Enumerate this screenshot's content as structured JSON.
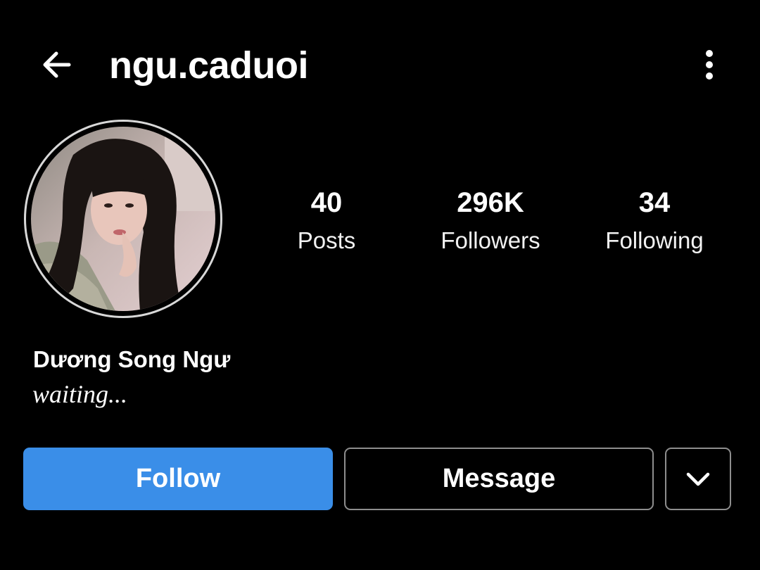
{
  "header": {
    "username": "ngu.caduoi",
    "back_icon": "arrow-left-icon",
    "more_icon": "vertical-dots-icon"
  },
  "profile": {
    "avatar": "profile-photo",
    "display_name": "Dương Song Ngư",
    "bio": "waiting..."
  },
  "stats": [
    {
      "value": "40",
      "label": "Posts"
    },
    {
      "value": "296K",
      "label": "Followers"
    },
    {
      "value": "34",
      "label": "Following"
    }
  ],
  "actions": {
    "follow_label": "Follow",
    "message_label": "Message",
    "more_icon": "chevron-down-icon"
  },
  "colors": {
    "background": "#000000",
    "text": "#ffffff",
    "follow_button": "#3a8ee8",
    "button_border": "#8e8e8e"
  }
}
